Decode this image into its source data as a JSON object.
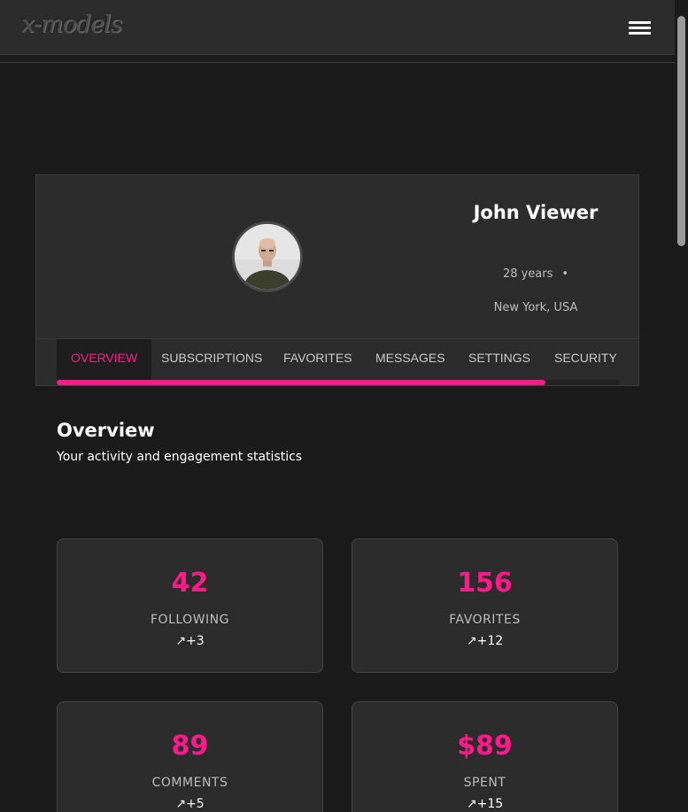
{
  "header": {
    "logo_text": "x-models",
    "menu_icon": "hamburger-menu-icon"
  },
  "profile": {
    "name": "John Viewer",
    "age": "28 years",
    "separator": "•",
    "location": "New York, USA"
  },
  "tabs": [
    {
      "label": "OVERVIEW",
      "active": true
    },
    {
      "label": "SUBSCRIPTIONS",
      "active": false
    },
    {
      "label": "FAVORITES",
      "active": false
    },
    {
      "label": "MESSAGES",
      "active": false
    },
    {
      "label": "SETTINGS",
      "active": false
    },
    {
      "label": "SECURITY",
      "active": false
    }
  ],
  "tab_scroll_progress": 0.87,
  "overview": {
    "title": "Overview",
    "subtitle": "Your activity and engagement statistics"
  },
  "stats": [
    {
      "value": "42",
      "label": "FOLLOWING",
      "trend": "↗+3"
    },
    {
      "value": "156",
      "label": "FAVORITES",
      "trend": "↗+12"
    },
    {
      "value": "89",
      "label": "COMMENTS",
      "trend": "↗+5"
    },
    {
      "value": "$89",
      "label": "SPENT",
      "trend": "↗+15"
    }
  ],
  "colors": {
    "accent": "#ff1a8c",
    "background": "#1b1b1b",
    "card": "#2c2c2c"
  }
}
